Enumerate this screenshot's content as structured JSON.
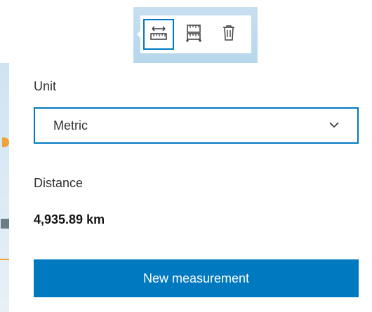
{
  "toolbar": {
    "tools": [
      {
        "icon": "measure-distance-icon",
        "active": true
      },
      {
        "icon": "measure-area-icon",
        "active": false
      },
      {
        "icon": "trash-icon",
        "active": false
      }
    ]
  },
  "panel": {
    "unit_label": "Unit",
    "unit_select": {
      "selected": "Metric",
      "icon": "chevron-down-icon"
    },
    "distance_label": "Distance",
    "distance_value": "4,935.89 km",
    "new_measurement_button": "New measurement"
  },
  "colors": {
    "accent": "#0079c1",
    "map_water": "#c7dff0",
    "map_feature": "#f0a33c",
    "text": "#323232"
  }
}
